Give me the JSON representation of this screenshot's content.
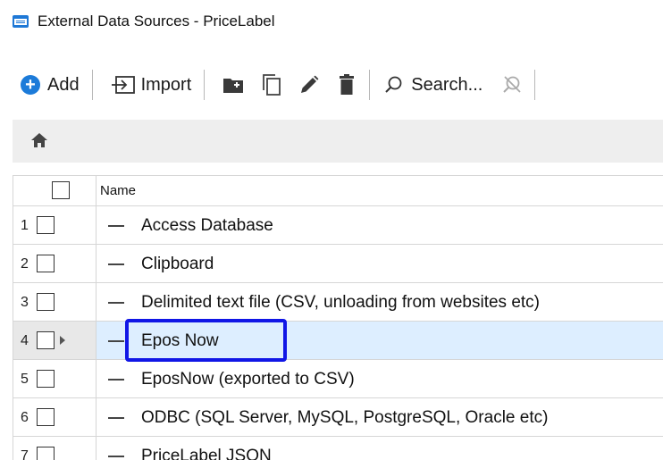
{
  "window": {
    "title": "External Data Sources - PriceLabel",
    "app_icon": "database-table-icon"
  },
  "toolbar": {
    "add_label": "Add",
    "import_label": "Import",
    "search_label": "Search...",
    "accent_color": "#1c7bd9",
    "icons": [
      "add-circle-icon",
      "import-icon",
      "new-folder-icon",
      "copy-icon",
      "edit-pencil-icon",
      "delete-trash-icon",
      "search-icon",
      "clear-search-icon"
    ]
  },
  "breadcrumb": {
    "icon": "home-icon"
  },
  "grid": {
    "column_header": "Name",
    "rows": [
      {
        "num": "1",
        "name": "Access Database"
      },
      {
        "num": "2",
        "name": "Clipboard"
      },
      {
        "num": "3",
        "name": "Delimited text file (CSV, unloading from websites etc)"
      },
      {
        "num": "4",
        "name": "Epos Now",
        "selected": true
      },
      {
        "num": "5",
        "name": "EposNow (exported to CSV)"
      },
      {
        "num": "6",
        "name": "ODBC (SQL Server, MySQL, PostgreSQL, Oracle etc)"
      },
      {
        "num": "7",
        "name": "PriceLabel JSON"
      }
    ],
    "selection_color": "#ddeeff",
    "highlight_color": "#1016e6"
  }
}
